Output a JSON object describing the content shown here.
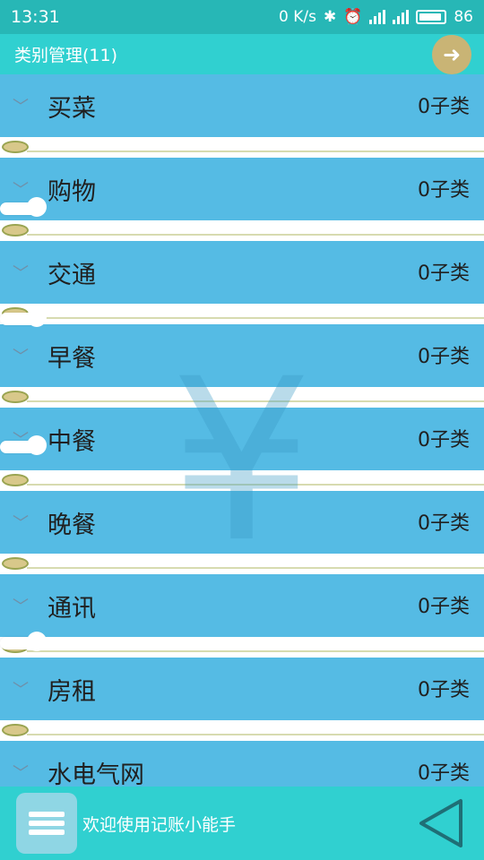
{
  "status_bar": {
    "time": "13:31",
    "net_speed": "0 K/s",
    "battery": "86"
  },
  "title_bar": {
    "title": "类别管理(11)",
    "back_icon": "arrow-down-circle-icon"
  },
  "categories": [
    {
      "label": "买菜",
      "count": "0子类"
    },
    {
      "label": "购物",
      "count": "0子类"
    },
    {
      "label": "交通",
      "count": "0子类"
    },
    {
      "label": "早餐",
      "count": "0子类"
    },
    {
      "label": "中餐",
      "count": "0子类"
    },
    {
      "label": "晚餐",
      "count": "0子类"
    },
    {
      "label": "通讯",
      "count": "0子类"
    },
    {
      "label": "房租",
      "count": "0子类"
    },
    {
      "label": "水电气网",
      "count": "0子类"
    }
  ],
  "watermark": "¥",
  "bottom_bar": {
    "message": "欢迎使用记账小能手"
  },
  "colors": {
    "status": "#27b7b6",
    "title": "#30d0d0",
    "row": "#55bbe4",
    "accent": "#c9b475"
  }
}
